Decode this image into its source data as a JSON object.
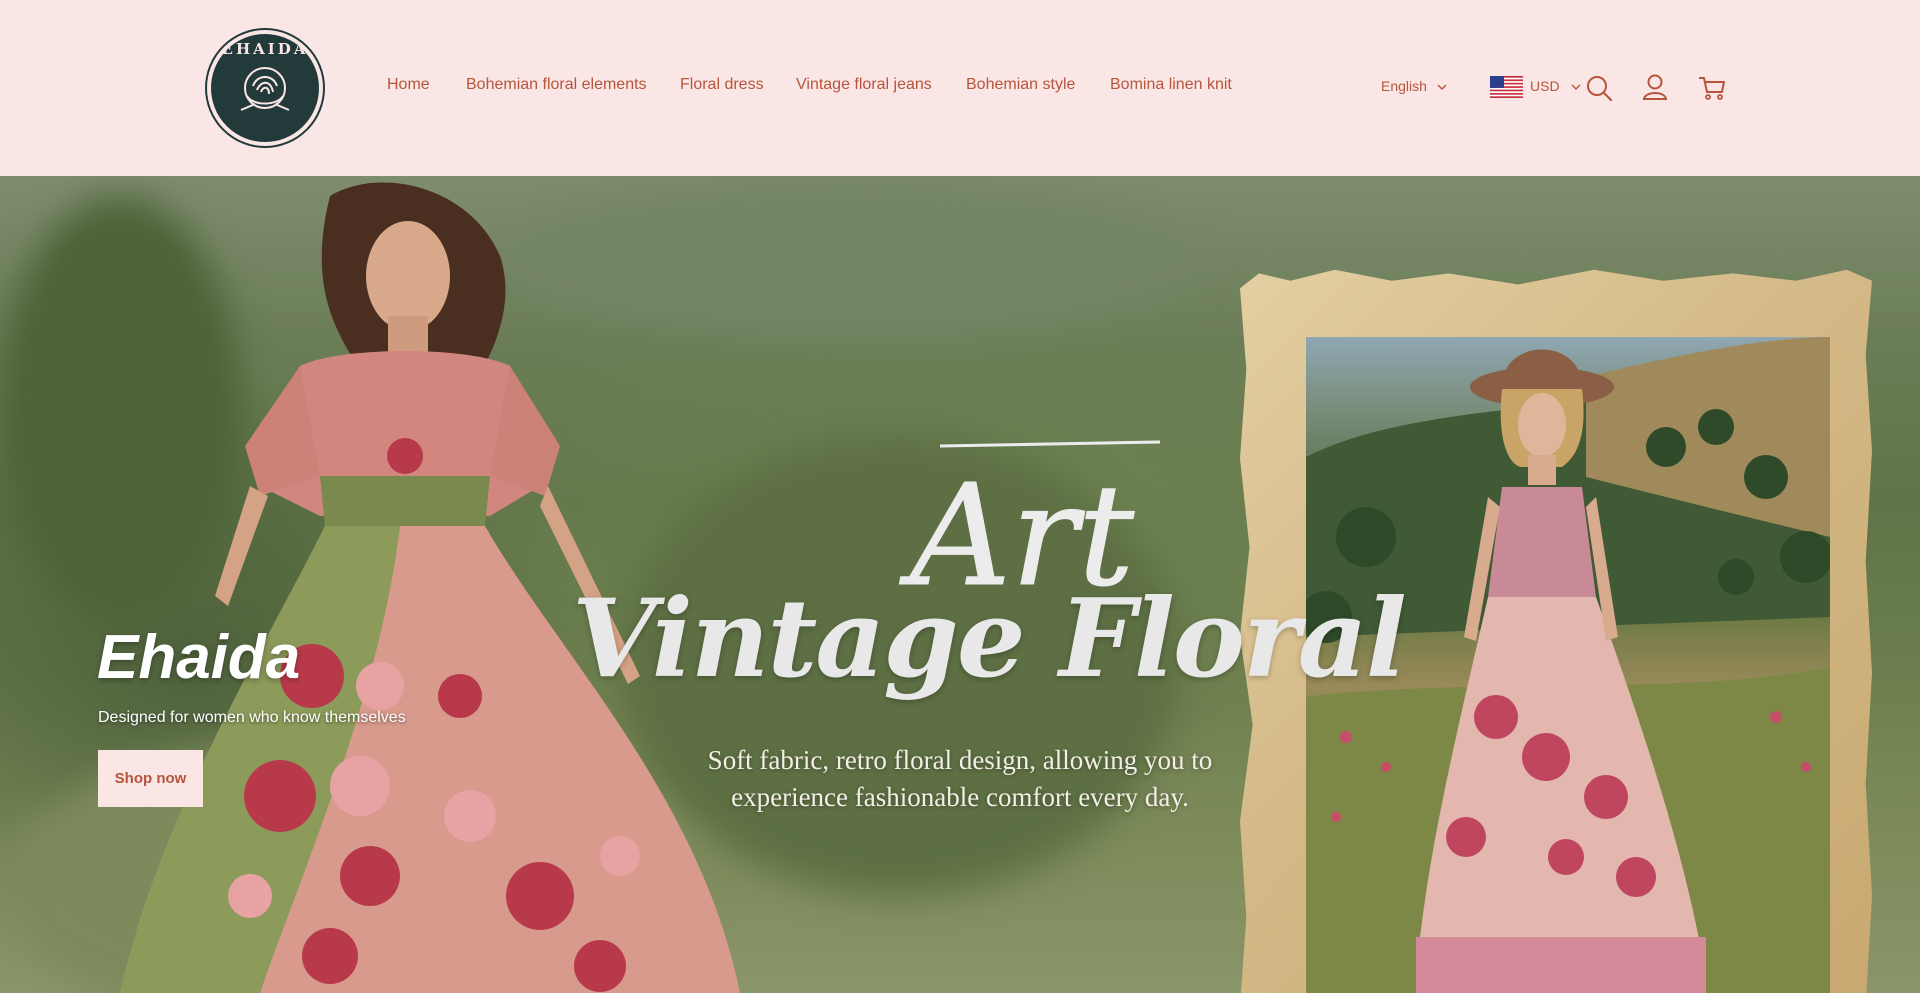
{
  "brand": {
    "logo_text": "EHAIDA",
    "title": "Ehaida",
    "tagline": "Designed for women who know themselves"
  },
  "nav": {
    "items": [
      {
        "label": "Home"
      },
      {
        "label": "Bohemian floral elements"
      },
      {
        "label": "Floral dress"
      },
      {
        "label": "Vintage floral jeans"
      },
      {
        "label": "Bohemian style"
      },
      {
        "label": "Bomina linen knit"
      }
    ]
  },
  "header": {
    "language": "English",
    "currency": "USD",
    "icons": [
      "search-icon",
      "account-icon",
      "cart-icon",
      "chevron-down-icon",
      "us-flag-icon"
    ]
  },
  "hero": {
    "script_word": "Art",
    "headline": "Vintage Floral",
    "subtitle": "Soft fabric, retro floral design, allowing you to experience fashionable comfort every day.",
    "cta_label": "Shop now"
  },
  "colors": {
    "header_bg": "#fbe6e6",
    "accent": "#b6553b",
    "logo_dark": "#233a3a"
  }
}
